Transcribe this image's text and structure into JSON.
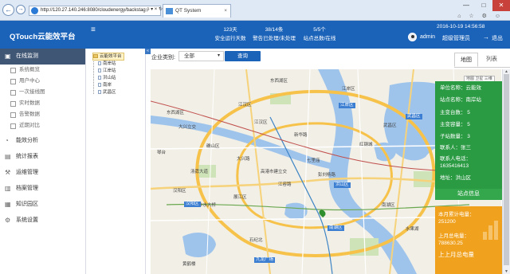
{
  "browser": {
    "url": "http://120.27.140.246:8080/cloudenergy/backstag",
    "addr_tools": "ρ ▾ × ↻",
    "tab_title": "QT System",
    "tab_close": "×",
    "back_icon": "back-arrow",
    "forward_icon": "forward-arrow",
    "window_controls": {
      "minimize": "—",
      "maximize": "□",
      "close": "✕"
    },
    "toolbar_icons": "⌂ ☆ ⚙ ☺"
  },
  "header": {
    "app_title": "QTouch云能效平台",
    "menu_toggle": "≡",
    "stats": [
      {
        "value": "123天",
        "label": "安全运行天数"
      },
      {
        "value": "38/14条",
        "label": "警告已处理/未处理"
      },
      {
        "value": "5/5个",
        "label": "站点总数/在线"
      }
    ],
    "datetime": "2016-10-19 14:56:58",
    "user": "admin",
    "role": "超级管理员",
    "logout_icon": "→",
    "logout": "退出"
  },
  "sidebar": {
    "active": {
      "label": "在线监测",
      "icon": "▣"
    },
    "subitems": [
      "系统概览",
      "用户中心",
      "一次接线图",
      "实时数据",
      "告警数据",
      "近期对比"
    ],
    "items": [
      {
        "label": "能效分析",
        "icon": "◔"
      },
      {
        "label": "统计报表",
        "icon": "▤"
      },
      {
        "label": "运维管理",
        "icon": "⚒"
      },
      {
        "label": "档案管理",
        "icon": "▥"
      },
      {
        "label": "知识园区",
        "icon": "▦"
      },
      {
        "label": "系统设置",
        "icon": "⚙"
      }
    ]
  },
  "tree": {
    "toggle": "«",
    "root": "云能效平台",
    "children": [
      "南岸站",
      "江岸站",
      "洪山站",
      "南岸",
      "武昌区"
    ]
  },
  "filter": {
    "label": "企业类别:",
    "select_value": "全部",
    "caret": "▾",
    "query_button": "查询",
    "tabs": [
      "地图",
      "列表"
    ]
  },
  "map": {
    "controls": "地图 卫星 三维",
    "labels": [
      "东西湖区",
      "江岸区",
      "江汉区",
      "东西湖区",
      "大兴立交",
      "江汉区",
      "新华路",
      "确山区",
      "江岸区",
      "武昌区",
      "武昌区",
      "红钢城",
      "汤孬大道",
      "大兴路",
      "七里庙",
      "琴台",
      "彭刘杨路",
      "高港市建立交",
      "江容路",
      "洪山区",
      "汉阳区",
      "展江区",
      "沙水大桥",
      "汉阳区",
      "南湖区",
      "南湖区",
      "水果湖",
      "石纪北",
      "九龙广场",
      "黄鹤楼"
    ]
  },
  "info_card": {
    "rows": [
      "单位名称：云能效",
      "站点名称：南岸站",
      "主变台数： 5",
      "主变容量： 5",
      "子站数量： 3",
      "联系人：张三",
      "联系人电话：",
      "1635416413",
      "地址：洪山区"
    ],
    "footer": "站点信息"
  },
  "energy_card": {
    "month_label": "本月累计电量：",
    "month_value": "251200",
    "last_label": "上月总电量：",
    "last_value": "788630.25",
    "prev_label": "上上月总电量"
  },
  "colors": {
    "brand": "#1b63b9",
    "sidebar_active": "#3f5674",
    "info_green": "#2a9a43",
    "energy_orange": "#f0a21f"
  }
}
